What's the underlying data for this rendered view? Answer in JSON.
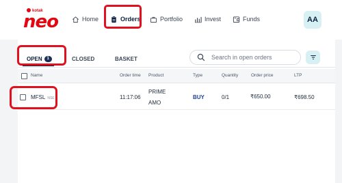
{
  "brand": {
    "tagline": "kotak",
    "name": "neo"
  },
  "nav": {
    "items": [
      {
        "label": "Home",
        "icon": "home-icon"
      },
      {
        "label": "Orders",
        "icon": "clipboard-icon",
        "active": true
      },
      {
        "label": "Portfolio",
        "icon": "briefcase-icon"
      },
      {
        "label": "Invest",
        "icon": "bar-chart-icon"
      },
      {
        "label": "Funds",
        "icon": "wallet-icon"
      }
    ],
    "avatar": "AA"
  },
  "tabs": {
    "open": {
      "label": "OPEN",
      "count": "1"
    },
    "closed": "CLOSED",
    "basket": "BASKET"
  },
  "search": {
    "placeholder": "Search in open orders",
    "value": ""
  },
  "table": {
    "columns": [
      "Name",
      "Order time",
      "Product",
      "Type",
      "Quantity",
      "Order price",
      "LTP"
    ],
    "rows": [
      {
        "name": "MFSL",
        "exchange": "NSE",
        "order_time": "11:17:06",
        "product_line1": "PRIME",
        "product_line2": "AMO",
        "type": "BUY",
        "quantity": "0/1",
        "order_price": "₹650.00",
        "ltp": "₹698.50"
      }
    ]
  },
  "colors": {
    "brand_red": "#e30613",
    "highlight_red": "#e0101f",
    "navy": "#1b2f57",
    "accent_teal": "#d6f0f3",
    "buy_blue": "#1f3fa3"
  }
}
